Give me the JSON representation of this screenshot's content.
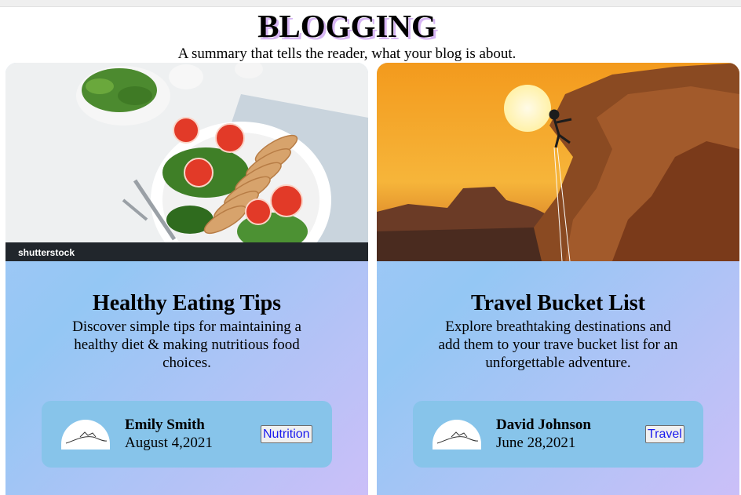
{
  "header": {
    "title": "BLOGGING",
    "subtitle": "A summary that tells the reader, what your blog is about."
  },
  "posts": [
    {
      "title": "Healthy Eating Tips",
      "description": "Discover simple tips for maintaining a healthy diet & making nutritious food choices.",
      "author": "Emily Smith",
      "date": "August 4,2021",
      "tag": "Nutrition",
      "image_icon": "salad-plate-photo",
      "watermark": "shutterstock"
    },
    {
      "title": "Travel Bucket List",
      "description": "Explore breathtaking destinations and add them to your trave bucket list for an unforgettable adventure.",
      "author": "David Johnson",
      "date": "June 28,2021",
      "tag": "Travel",
      "image_icon": "rock-climber-sunset-photo"
    }
  ],
  "colors": {
    "title_shadow": "#d7b6f4",
    "card_gradient_start": "#a9c8f8",
    "card_gradient_end": "#cbbff8",
    "author_box": "#87c4ea",
    "tag_text": "#1a1aee"
  }
}
